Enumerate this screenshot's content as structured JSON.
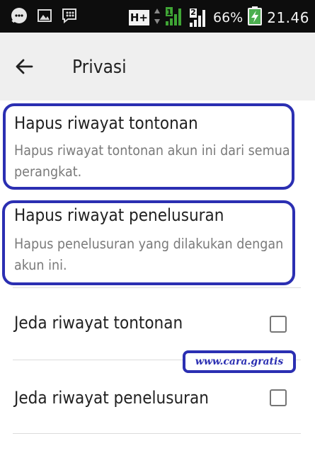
{
  "status_bar": {
    "network_type": "H+",
    "sim2_label": "2",
    "battery_percent": "66%",
    "time": "21.46",
    "icons": [
      "chat-notification-icon",
      "image-notification-icon",
      "bbm-notification-icon",
      "network-type-icon",
      "data-arrows-icon",
      "signal-sim1-icon",
      "signal-sim2-icon",
      "battery-charging-icon"
    ]
  },
  "app_bar": {
    "title": "Privasi",
    "back_icon": "arrow-left-icon"
  },
  "settings": {
    "items": [
      {
        "title": "Hapus riwayat tontonan",
        "description": "Hapus riwayat tontonan akun ini dari semua perangkat."
      },
      {
        "title": "Hapus riwayat penelusuran",
        "description": "Hapus penelusuran yang dilakukan dengan akun ini."
      },
      {
        "title": "Jeda riwayat tontonan",
        "checked": false
      },
      {
        "title": "Jeda riwayat penelusuran",
        "checked": false
      }
    ]
  },
  "watermark": {
    "text": "www.cara.gratis"
  },
  "colors": {
    "status_bar_bg": "#0d0d0d",
    "app_bar_bg": "#efefef",
    "highlight": "#2b2fb2",
    "battery_green": "#4caf50",
    "signal_green": "#3fa535"
  }
}
